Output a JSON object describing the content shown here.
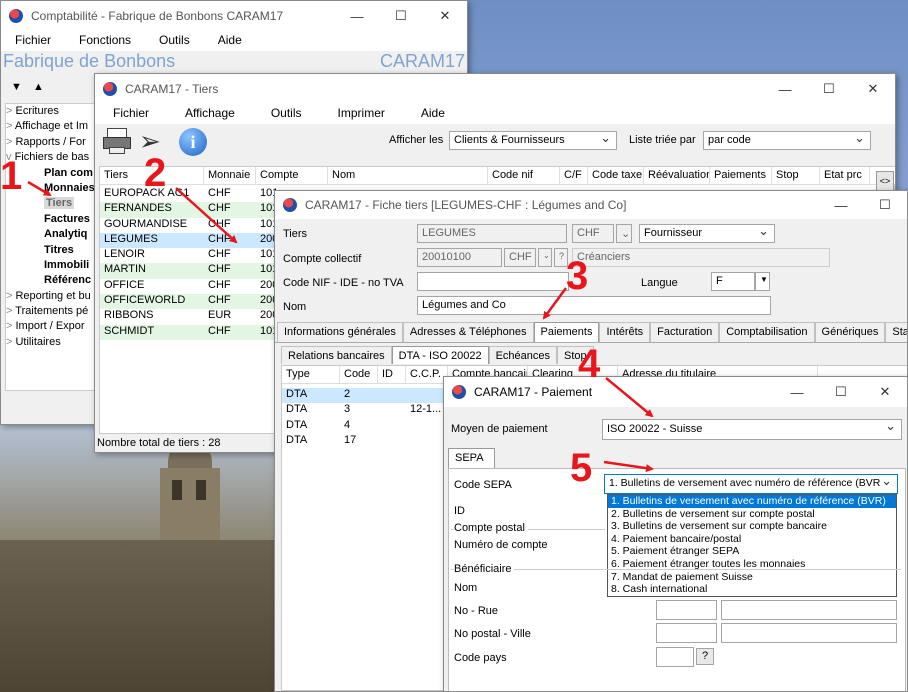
{
  "main_window": {
    "title": "Comptabilité - Fabrique de Bonbons CARAM17",
    "menu": [
      "Fichier",
      "Fonctions",
      "Outils",
      "Aide"
    ],
    "banner_left": "Fabrique de Bonbons",
    "banner_right": "CARAM17",
    "nav_arrows": [
      "▼",
      "▲"
    ],
    "tree": [
      {
        "label": "Ecritures",
        "bold": false,
        "indent": 0,
        "arrow": ">"
      },
      {
        "label": "Affichage et Im",
        "bold": false,
        "indent": 0,
        "arrow": ">"
      },
      {
        "label": "Rapports / For",
        "bold": false,
        "indent": 0,
        "arrow": ">"
      },
      {
        "label": "Fichiers de bas",
        "bold": false,
        "indent": 0,
        "arrow": "v"
      },
      {
        "label": "Plan com",
        "bold": true,
        "indent": 1,
        "arrow": ""
      },
      {
        "label": "Monnaies",
        "bold": true,
        "indent": 1,
        "arrow": ""
      },
      {
        "label": "Tiers",
        "bold": true,
        "indent": 1,
        "arrow": "",
        "selected": true
      },
      {
        "label": "Factures",
        "bold": true,
        "indent": 1,
        "arrow": ""
      },
      {
        "label": "Analytiq",
        "bold": true,
        "indent": 1,
        "arrow": ""
      },
      {
        "label": "Titres",
        "bold": true,
        "indent": 1,
        "arrow": ""
      },
      {
        "label": "Immobili",
        "bold": true,
        "indent": 1,
        "arrow": ""
      },
      {
        "label": "Référenc",
        "bold": true,
        "indent": 1,
        "arrow": ""
      },
      {
        "label": "Reporting et bu",
        "bold": false,
        "indent": 0,
        "arrow": ">"
      },
      {
        "label": "Traitements pé",
        "bold": false,
        "indent": 0,
        "arrow": ">"
      },
      {
        "label": "Import / Expor",
        "bold": false,
        "indent": 0,
        "arrow": ">"
      },
      {
        "label": "Utilitaires",
        "bold": false,
        "indent": 0,
        "arrow": ">"
      }
    ]
  },
  "tiers_window": {
    "title": "CARAM17 - Tiers",
    "menu": [
      "Fichier",
      "Affichage",
      "Outils",
      "Imprimer",
      "Aide"
    ],
    "afficher_label": "Afficher les",
    "afficher_value": "Clients & Fournisseurs",
    "tri_label": "Liste triée par",
    "tri_value": "par code",
    "columns": [
      "Tiers",
      "Monnaie",
      "Compte",
      "Nom",
      "Code nif",
      "C/F",
      "Code taxe",
      "Réévaluatior",
      "Paiements",
      "Stop",
      "Etat prc"
    ],
    "rows": [
      {
        "tiers": "EUROPACK AG1",
        "monnaie": "CHF",
        "compte": "101"
      },
      {
        "tiers": "FERNANDES",
        "monnaie": "CHF",
        "compte": "101"
      },
      {
        "tiers": "GOURMANDISE",
        "monnaie": "CHF",
        "compte": "101"
      },
      {
        "tiers": "LEGUMES",
        "monnaie": "CHF",
        "compte": "200",
        "selected": true
      },
      {
        "tiers": "LENOIR",
        "monnaie": "CHF",
        "compte": "101"
      },
      {
        "tiers": "MARTIN",
        "monnaie": "CHF",
        "compte": "101"
      },
      {
        "tiers": "OFFICE",
        "monnaie": "CHF",
        "compte": "200"
      },
      {
        "tiers": "OFFICEWORLD",
        "monnaie": "CHF",
        "compte": "200"
      },
      {
        "tiers": "RIBBONS",
        "monnaie": "EUR",
        "compte": "200"
      },
      {
        "tiers": "SCHMIDT",
        "monnaie": "CHF",
        "compte": "101"
      }
    ],
    "status": "Nombre total de tiers : 28",
    "scroll_btn": "<>"
  },
  "fiche_window": {
    "title": "CARAM17 - Fiche tiers [LEGUMES-CHF : Légumes and Co]",
    "tiers_label": "Tiers",
    "tiers_value": "LEGUMES",
    "monnaie_value": "CHF",
    "type_value": "Fournisseur",
    "compte_label": "Compte collectif",
    "compte_value": "20010100",
    "compte_monnaie": "CHF",
    "compte_desc": "Créanciers",
    "nif_label": "Code NIF - IDE - no TVA",
    "langue_label": "Langue",
    "langue_value": "F",
    "nom_label": "Nom",
    "nom_value": "Légumes and Co",
    "tabs": [
      "Informations générales",
      "Adresses & Téléphones",
      "Paiements",
      "Intérêts",
      "Facturation",
      "Comptabilisation",
      "Génériques",
      "Statistiques"
    ],
    "subtabs": [
      "Relations bancaires",
      "DTA - ISO 20022",
      "Echéances",
      "Stop"
    ],
    "pay_columns": [
      "Type",
      "Code",
      "ID",
      "C.C.P.",
      "Compte bancaire",
      "Clearing",
      "Adresse du titulaire"
    ],
    "pay_rows": [
      {
        "type": "DTA",
        "code": "2",
        "ccp": "",
        "selected": true
      },
      {
        "type": "DTA",
        "code": "3",
        "ccp": "12-1..."
      },
      {
        "type": "DTA",
        "code": "4",
        "ccp": ""
      },
      {
        "type": "DTA",
        "code": "17",
        "ccp": ""
      }
    ]
  },
  "paiement_window": {
    "title": "CARAM17 - Paiement",
    "moyen_label": "Moyen de paiement",
    "moyen_value": "ISO 20022 - Suisse",
    "tab": "SEPA",
    "code_sepa_label": "Code SEPA",
    "code_sepa_value": "1. Bulletins de versement avec numéro de référence (BVR",
    "options": [
      "1. Bulletins de versement avec numéro de référence (BVR)",
      "2. Bulletins de versement sur compte postal",
      "3. Bulletins de versement sur compte bancaire",
      "4. Paiement bancaire/postal",
      "5. Paiement étranger SEPA",
      "6. Paiement étranger toutes les monnaies",
      "7. Mandat de paiement Suisse",
      "8. Cash international"
    ],
    "id_label": "ID",
    "compte_postal_group": "Compte postal",
    "numero_label": "Numéro de compte",
    "beneficiaire_group": "Bénéficiaire",
    "nom_label": "Nom",
    "rue_label": "No - Rue",
    "postal_label": "No postal - Ville",
    "pays_label": "Code pays",
    "pays_btn": "?"
  },
  "annotations": [
    "1",
    "2",
    "3",
    "4",
    "5"
  ],
  "colors": {
    "annotation": "#e8161b",
    "banner_text": "#7fa3d0",
    "selection": "#cce8ff",
    "highlight": "#0078d7"
  }
}
